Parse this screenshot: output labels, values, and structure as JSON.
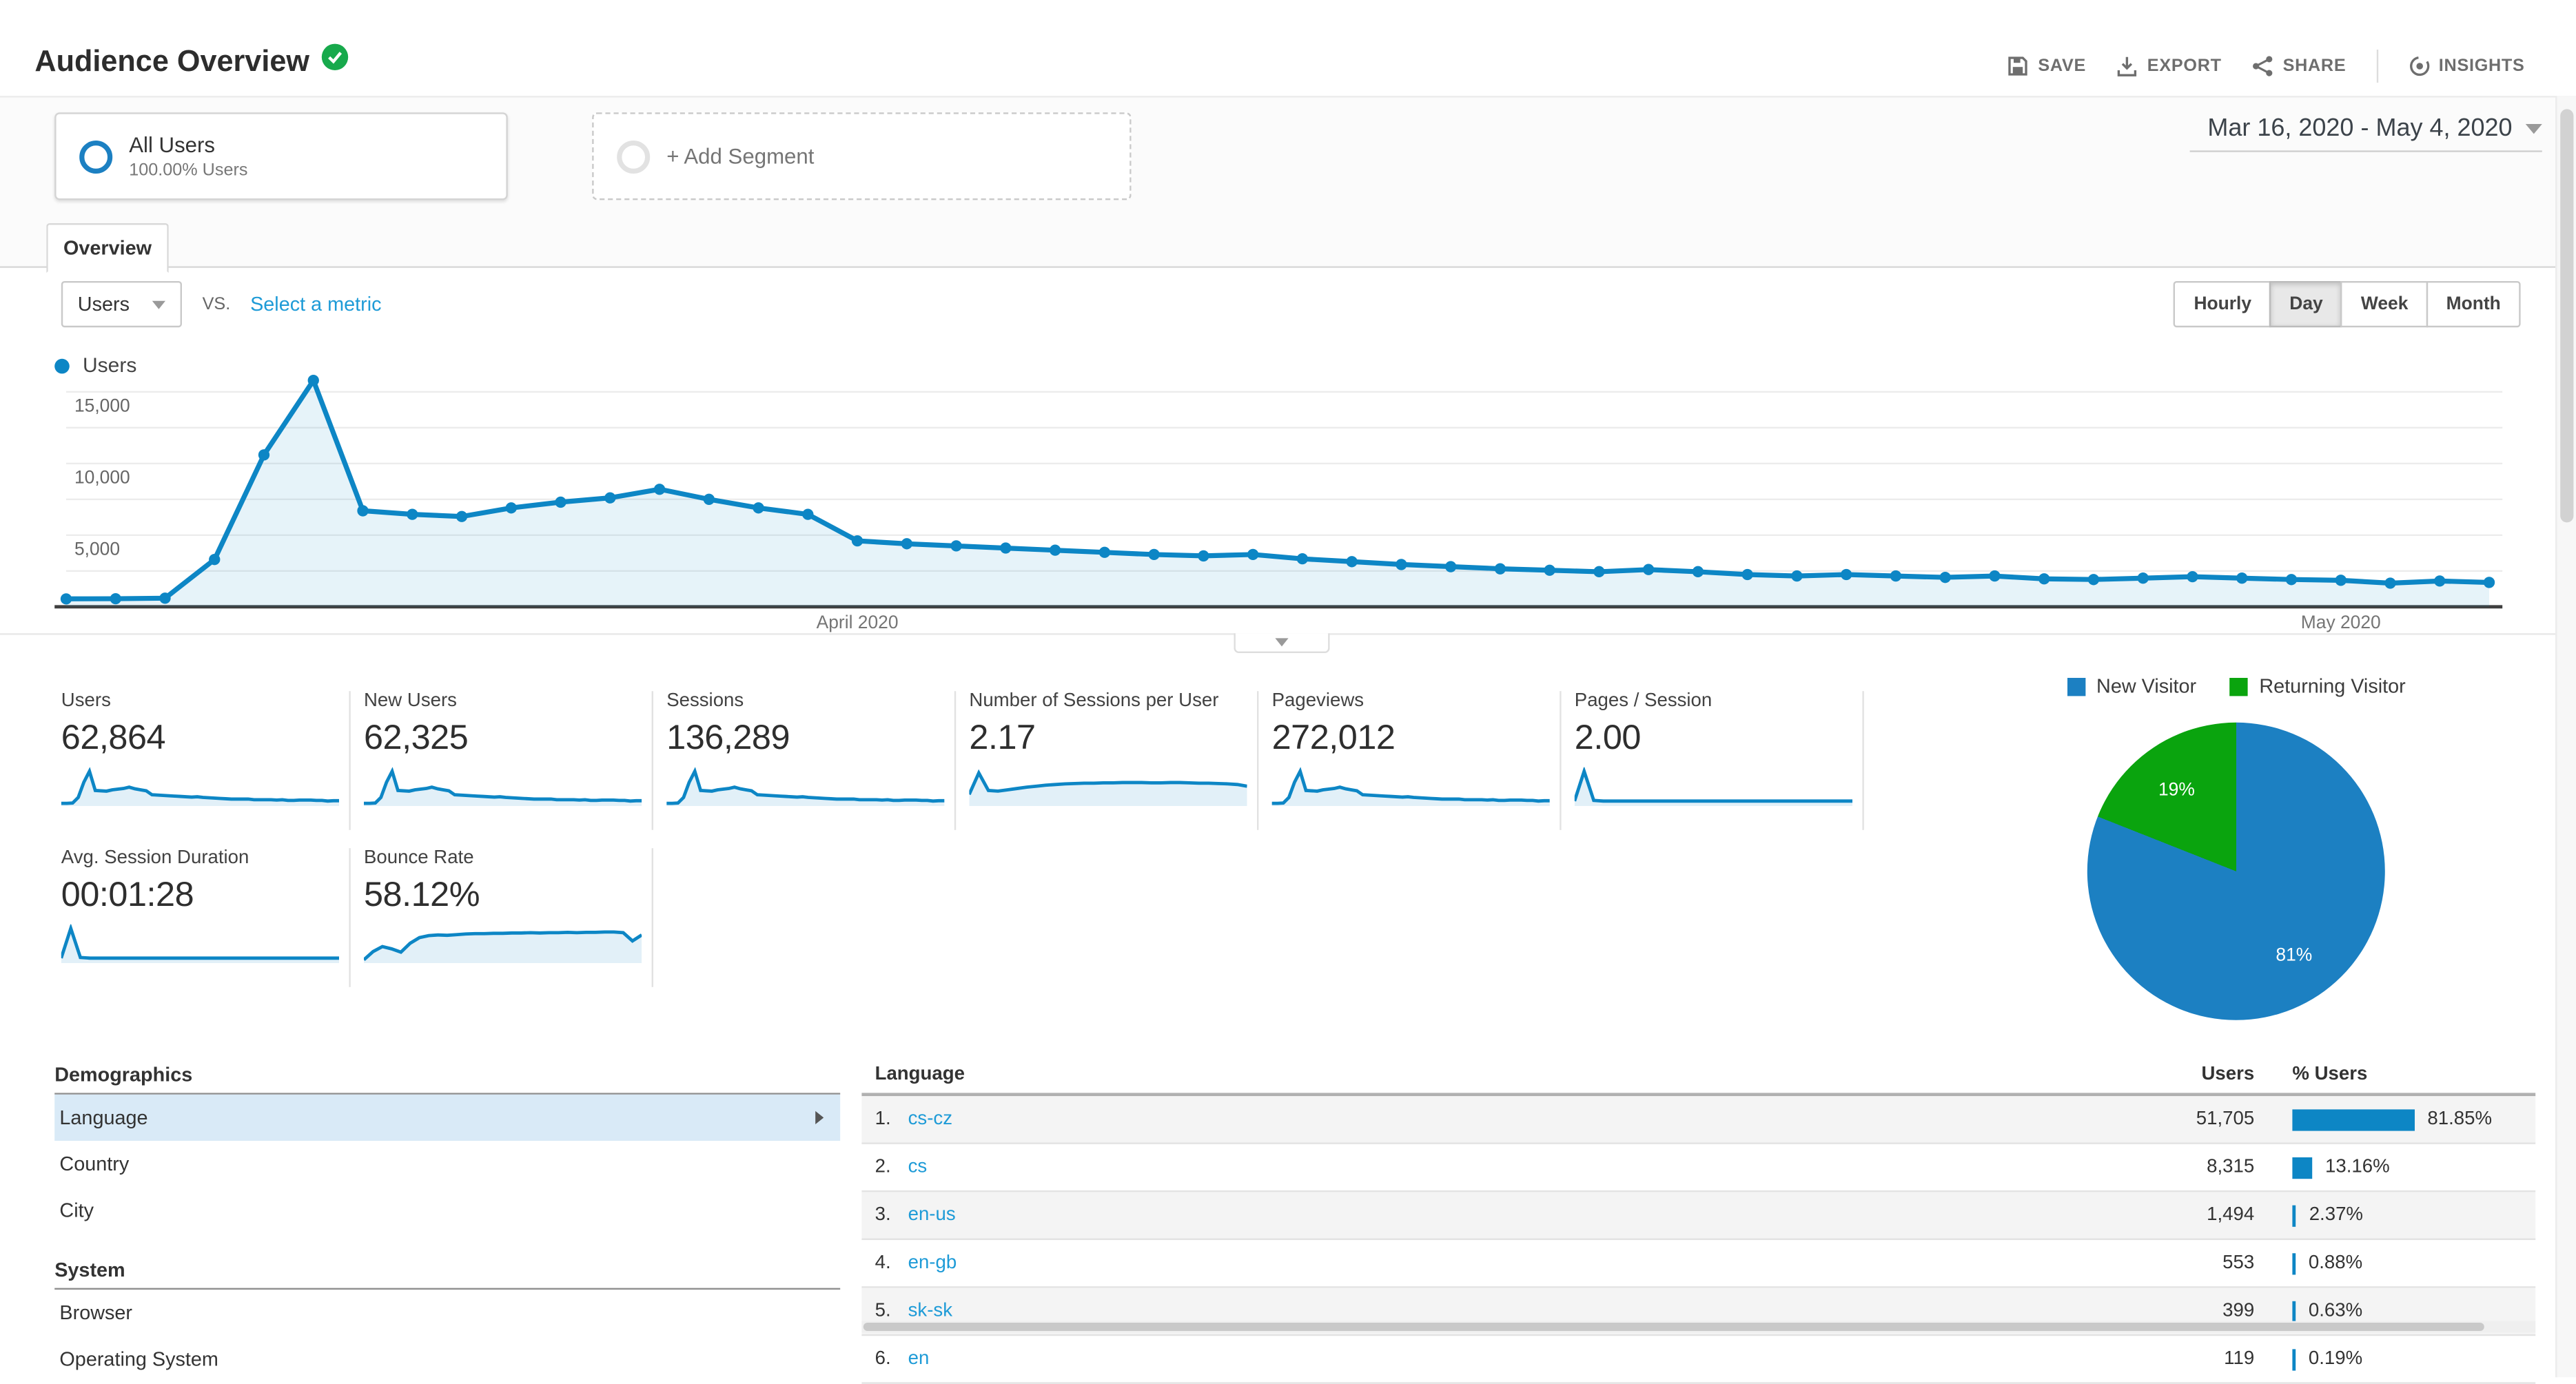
{
  "header": {
    "title": "Audience Overview",
    "status_icon": "verified-badge",
    "actions": [
      {
        "label": "SAVE",
        "icon": "save-icon"
      },
      {
        "label": "EXPORT",
        "icon": "export-icon"
      },
      {
        "label": "SHARE",
        "icon": "share-icon"
      },
      {
        "label": "INSIGHTS",
        "icon": "insights-icon",
        "divider_before": true
      }
    ]
  },
  "segments": {
    "all_users": {
      "title": "All Users",
      "subtitle": "100.00% Users"
    },
    "add_segment_label": "+ Add Segment"
  },
  "date_range": "Mar 16, 2020 - May 4, 2020",
  "tabs": [
    "Overview"
  ],
  "metric_picker": {
    "selected": "Users",
    "vs_label": "VS.",
    "select_link": "Select a metric"
  },
  "granularity": {
    "options": [
      "Hourly",
      "Day",
      "Week",
      "Month"
    ],
    "selected": "Day"
  },
  "colors": {
    "accent_blue": "#0d86c5",
    "pie_blue": "#1c80c2",
    "pie_green": "#0aa40e",
    "link_blue": "#1e9bd7",
    "selected_row_bg": "#d9eaf7"
  },
  "chart_data": [
    {
      "type": "line",
      "title": "Users by day",
      "x_start": "Mar 16, 2020",
      "x_end": "May 4, 2020",
      "x_unit": "day",
      "series": [
        {
          "name": "Users",
          "color": "#0d86c5",
          "values": [
            550,
            560,
            600,
            3300,
            10600,
            15800,
            6700,
            6450,
            6300,
            6900,
            7300,
            7600,
            8200,
            7500,
            6900,
            6450,
            4600,
            4400,
            4250,
            4100,
            3950,
            3800,
            3650,
            3550,
            3650,
            3350,
            3150,
            2950,
            2800,
            2650,
            2550,
            2450,
            2600,
            2450,
            2250,
            2150,
            2250,
            2150,
            2050,
            2150,
            1950,
            1900,
            2000,
            2100,
            2000,
            1900,
            1850,
            1650,
            1800,
            1700
          ]
        }
      ],
      "x_tick_labels": [
        {
          "label": "April 2020",
          "day_index": 16
        },
        {
          "label": "May 2020",
          "day_index": 46
        }
      ],
      "y_ticks": [
        5000,
        10000,
        15000
      ],
      "y_gridlines": [
        2500,
        5000,
        7500,
        10000,
        12500,
        15000
      ],
      "ylim": [
        0,
        16500
      ],
      "legend": [
        "Users"
      ],
      "legend_position": "top-left",
      "grid": true
    },
    {
      "type": "pie",
      "title": "New vs Returning Visitors",
      "labels": [
        "New Visitor",
        "Returning Visitor"
      ],
      "values": [
        81,
        19
      ],
      "colors": [
        "#1c80c2",
        "#0aa40e"
      ],
      "data_labels": [
        "81%",
        "19%"
      ],
      "legend_position": "top"
    }
  ],
  "scorecards": {
    "spark_shapes": {
      "peak": [
        3,
        3,
        4,
        21,
        67,
        100,
        42,
        41,
        40,
        44,
        46,
        48,
        52,
        47,
        44,
        41,
        29,
        28,
        27,
        26,
        25,
        24,
        23,
        22,
        23,
        21,
        20,
        19,
        18,
        17,
        16,
        16,
        16,
        16,
        14,
        14,
        14,
        14,
        13,
        14,
        12,
        12,
        13,
        13,
        13,
        12,
        12,
        10,
        11,
        11
      ],
      "plateau": [
        30,
        95,
        42,
        40,
        44,
        48,
        52,
        55,
        58,
        60,
        62,
        63,
        64,
        64,
        65,
        65,
        66,
        66,
        66,
        65,
        65,
        66,
        66,
        65,
        64,
        64,
        63,
        62,
        60,
        55
      ],
      "spike_flat": [
        10,
        100,
        12,
        10,
        10,
        10,
        10,
        10,
        10,
        10,
        10,
        10,
        10,
        10,
        10,
        10,
        10,
        10,
        10,
        10,
        10,
        10,
        10,
        10,
        10,
        10,
        10,
        10,
        10,
        10
      ],
      "bounce": [
        5,
        30,
        45,
        38,
        28,
        55,
        72,
        78,
        80,
        79,
        81,
        83,
        84,
        84,
        85,
        85,
        86,
        86,
        87,
        86,
        87,
        87,
        88,
        87,
        88,
        88,
        89,
        89,
        87,
        62,
        80
      ]
    },
    "rows": [
      [
        {
          "label": "Users",
          "value": "62,864",
          "spark": "peak"
        },
        {
          "label": "New Users",
          "value": "62,325",
          "spark": "peak"
        },
        {
          "label": "Sessions",
          "value": "136,289",
          "spark": "peak"
        },
        {
          "label": "Number of Sessions per User",
          "value": "2.17",
          "spark": "plateau"
        },
        {
          "label": "Pageviews",
          "value": "272,012",
          "spark": "peak"
        },
        {
          "label": "Pages / Session",
          "value": "2.00",
          "spark": "spike_flat"
        }
      ],
      [
        {
          "label": "Avg. Session Duration",
          "value": "00:01:28",
          "spark": "spike_flat"
        },
        {
          "label": "Bounce Rate",
          "value": "58.12%",
          "spark": "bounce"
        }
      ]
    ]
  },
  "explorer": {
    "nav": {
      "sections": [
        {
          "title": "Demographics",
          "items": [
            {
              "label": "Language",
              "selected": true
            },
            {
              "label": "Country"
            },
            {
              "label": "City"
            }
          ]
        },
        {
          "title": "System",
          "items": [
            {
              "label": "Browser"
            },
            {
              "label": "Operating System"
            }
          ]
        }
      ]
    },
    "table": {
      "columns": [
        "Language",
        "Users",
        "% Users"
      ],
      "rows": [
        {
          "rank": "1.",
          "language": "cs-cz",
          "users": "51,705",
          "pct_label": "81.85%",
          "pct": 81.85
        },
        {
          "rank": "2.",
          "language": "cs",
          "users": "8,315",
          "pct_label": "13.16%",
          "pct": 13.16
        },
        {
          "rank": "3.",
          "language": "en-us",
          "users": "1,494",
          "pct_label": "2.37%",
          "pct": 2.37
        },
        {
          "rank": "4.",
          "language": "en-gb",
          "users": "553",
          "pct_label": "0.88%",
          "pct": 0.88
        },
        {
          "rank": "5.",
          "language": "sk-sk",
          "users": "399",
          "pct_label": "0.63%",
          "pct": 0.63
        },
        {
          "rank": "6.",
          "language": "en",
          "users": "119",
          "pct_label": "0.19%",
          "pct": 0.19
        }
      ]
    }
  }
}
